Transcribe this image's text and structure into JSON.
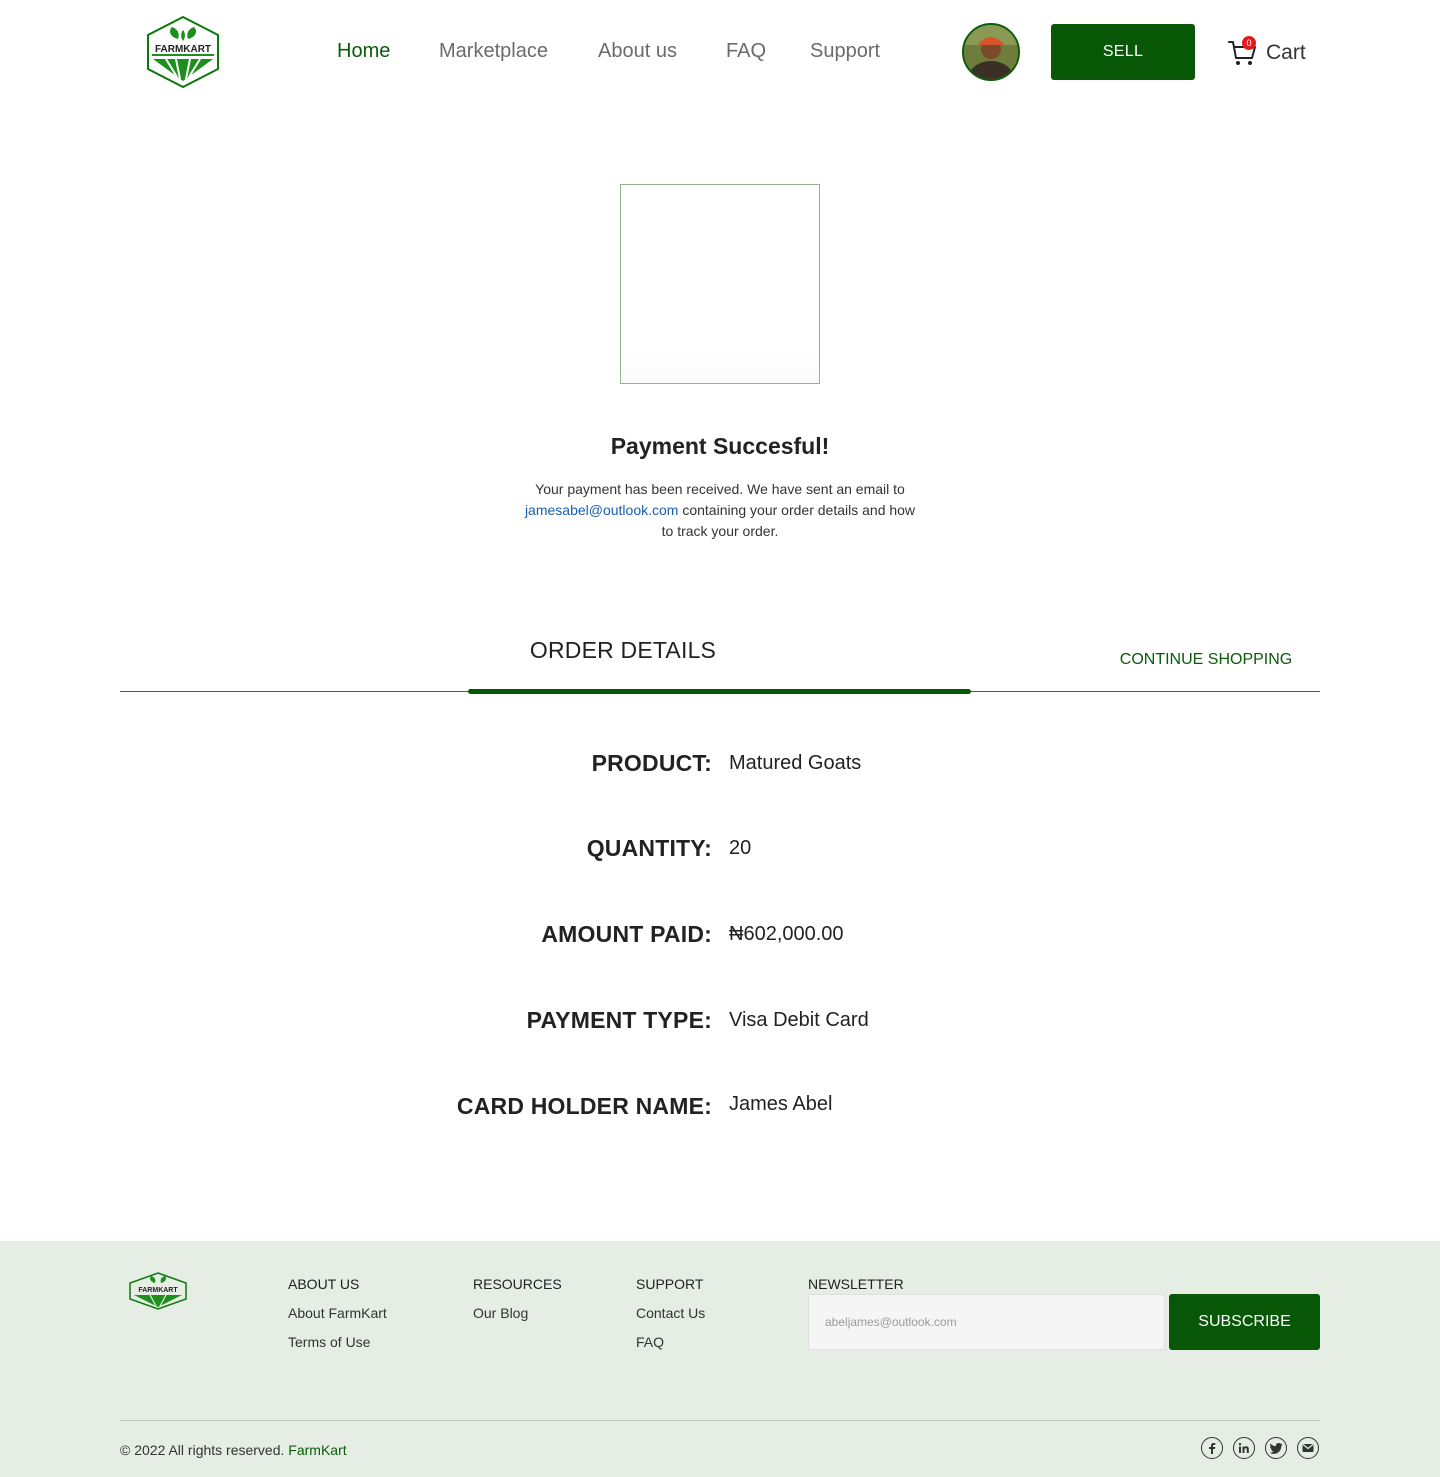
{
  "header": {
    "logo_text": "FARMKART",
    "nav": [
      {
        "label": "Home",
        "active": true
      },
      {
        "label": "Marketplace",
        "active": false
      },
      {
        "label": "About us",
        "active": false
      },
      {
        "label": "FAQ",
        "active": false
      },
      {
        "label": "Support",
        "active": false
      }
    ],
    "sell_label": "SELL",
    "cart_count": "0",
    "cart_label": "Cart"
  },
  "success": {
    "title": "Payment Succesful!",
    "message_before": "Your payment has been received. We have sent an email to",
    "email": "jamesabel@outlook.com",
    "message_after": "containing your order details and how to track your order."
  },
  "order": {
    "tab_title": "ORDER DETAILS",
    "continue_label": "CONTINUE SHOPPING",
    "rows": [
      {
        "label": "PRODUCT:",
        "value": "Matured Goats"
      },
      {
        "label": "QUANTITY:",
        "value": "20"
      },
      {
        "label": "AMOUNT PAID:",
        "value": "₦602,000.00"
      },
      {
        "label": "PAYMENT TYPE:",
        "value": "Visa Debit Card"
      },
      {
        "label": "CARD HOLDER NAME:",
        "value": "James Abel"
      }
    ]
  },
  "footer": {
    "logo_text": "FARMKART",
    "about": {
      "heading": "ABOUT US",
      "links": [
        "About FarmKart",
        "Terms of Use"
      ]
    },
    "resources": {
      "heading": "RESOURCES",
      "links": [
        "Our Blog"
      ]
    },
    "support": {
      "heading": "SUPPORT",
      "links": [
        "Contact Us",
        "FAQ"
      ]
    },
    "newsletter": {
      "heading": "NEWSLETTER",
      "placeholder": "abeljames@outlook.com",
      "button": "SUBSCRIBE"
    },
    "copyright": "© 2022 All rights reserved.",
    "brand": "FarmKart",
    "socials": [
      "facebook-icon",
      "linkedin-icon",
      "twitter-icon",
      "mail-icon"
    ]
  },
  "colors": {
    "brand_green": "#075707",
    "link_blue": "#1a5fb4",
    "footer_bg": "#e5ede5",
    "badge_red": "#e21c1c"
  }
}
